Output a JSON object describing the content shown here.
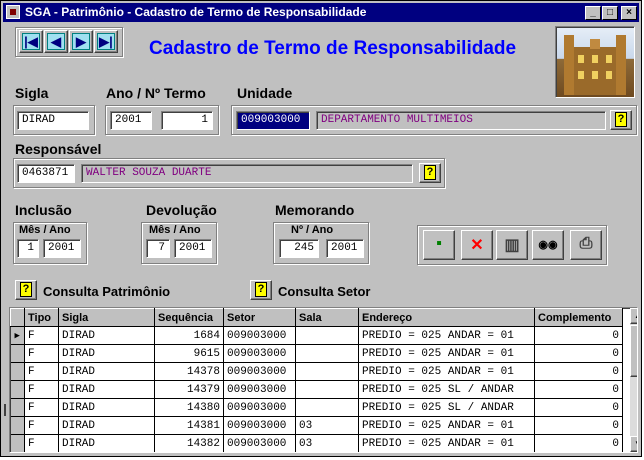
{
  "window": {
    "title": "SGA - Patrimônio - Cadastro de Termo de Responsabilidade",
    "controls": [
      "_",
      "□",
      "×"
    ]
  },
  "nav": {
    "buttons": [
      {
        "name": "first-record-button",
        "icon": "first-record-icon",
        "glyph": "|◀"
      },
      {
        "name": "prev-record-button",
        "icon": "arrow-left-icon",
        "glyph": "◀"
      },
      {
        "name": "next-record-button",
        "icon": "arrow-right-icon",
        "glyph": "▶"
      },
      {
        "name": "last-record-button",
        "icon": "last-record-icon",
        "glyph": "▶|"
      }
    ]
  },
  "header": {
    "title": "Cadastro de Termo de Responsabilidade"
  },
  "form": {
    "sigla_label": "Sigla",
    "sigla_value": "DIRAD",
    "ano_termo_label": "Ano  /  Nº Termo",
    "ano_value": "2001",
    "termo_value": "1",
    "unidade_label": "Unidade",
    "unidade_code": "009003000",
    "unidade_name": "DEPARTAMENTO MULTIMEIOS",
    "responsavel_label": "Responsável",
    "responsavel_code": "0463871",
    "responsavel_name": "WALTER SOUZA DUARTE",
    "inclusao_label": "Inclusão",
    "inclusao_mes_ano_label": "Mês / Ano",
    "inclusao_mes": "1",
    "inclusao_ano": "2001",
    "devolucao_label": "Devolução",
    "devolucao_mes_ano_label": "Mês / Ano",
    "devolucao_mes": "7",
    "devolucao_ano": "2001",
    "memorando_label": "Memorando",
    "memorando_n_ano_label": "Nº    /  Ano",
    "memorando_n": "245",
    "memorando_ano": "2001",
    "help_glyph": "?"
  },
  "actions": {
    "save_glyph": "▪",
    "delete_glyph": "✕",
    "trash_glyph": "▥",
    "find_glyph": "◉◉",
    "print_glyph": "⎙"
  },
  "links": {
    "consulta_patrimonio": "Consulta Patrimônio",
    "consulta_setor": "Consulta Setor"
  },
  "grid": {
    "columns": [
      "Tipo",
      "Sigla",
      "Sequência",
      "Setor",
      "Sala",
      "Endereço",
      "Complemento"
    ],
    "current_row_marker": "▶",
    "rows": [
      {
        "tipo": "F",
        "sigla": "DIRAD",
        "sequencia": "1684",
        "setor": "009003000",
        "sala": "",
        "endereco": "PREDIO = 025 ANDAR =  01",
        "complemento": "0"
      },
      {
        "tipo": "F",
        "sigla": "DIRAD",
        "sequencia": "9615",
        "setor": "009003000",
        "sala": "",
        "endereco": "PREDIO = 025 ANDAR =  01",
        "complemento": "0"
      },
      {
        "tipo": "F",
        "sigla": "DIRAD",
        "sequencia": "14378",
        "setor": "009003000",
        "sala": "",
        "endereco": "PREDIO = 025 ANDAR =  01",
        "complemento": "0"
      },
      {
        "tipo": "F",
        "sigla": "DIRAD",
        "sequencia": "14379",
        "setor": "009003000",
        "sala": "",
        "endereco": "PREDIO = 025  SL / ANDAR",
        "complemento": "0"
      },
      {
        "tipo": "F",
        "sigla": "DIRAD",
        "sequencia": "14380",
        "setor": "009003000",
        "sala": "",
        "endereco": "PREDIO = 025  SL / ANDAR",
        "complemento": "0"
      },
      {
        "tipo": "F",
        "sigla": "DIRAD",
        "sequencia": "14381",
        "setor": "009003000",
        "sala": "03",
        "endereco": "PREDIO = 025  ANDAR = 01",
        "complemento": "0"
      },
      {
        "tipo": "F",
        "sigla": "DIRAD",
        "sequencia": "14382",
        "setor": "009003000",
        "sala": "03",
        "endereco": "PREDIO = 025  ANDAR = 01",
        "complemento": "0"
      }
    ]
  },
  "scrollbar": {
    "up_glyph": "▲",
    "down_glyph": "▼"
  }
}
